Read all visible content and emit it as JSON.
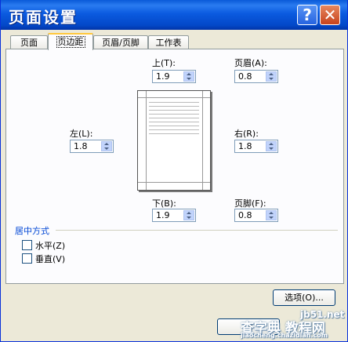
{
  "window": {
    "title": "页面设置"
  },
  "titlebar": {
    "help_glyph": "?",
    "close_glyph": "✕"
  },
  "tabs": [
    "页面",
    "页边距",
    "页眉/页脚",
    "工作表"
  ],
  "margins": {
    "top": {
      "label": "上(T):",
      "value": "1.9"
    },
    "header": {
      "label": "页眉(A):",
      "value": "0.8"
    },
    "left": {
      "label": "左(L):",
      "value": "1.8"
    },
    "right": {
      "label": "右(R):",
      "value": "1.8"
    },
    "bottom": {
      "label": "下(B):",
      "value": "1.9"
    },
    "footer": {
      "label": "页脚(F):",
      "value": "0.8"
    }
  },
  "center": {
    "group_label": "居中方式",
    "horizontal": {
      "label": "水平(Z)",
      "checked": false
    },
    "vertical": {
      "label": "垂直(V)",
      "checked": false
    }
  },
  "buttons": {
    "options": "选项(O)...",
    "ok": "确"
  },
  "watermark": {
    "line1": "jb51.net",
    "line2": "查字典 教程网",
    "line3": "jiaocheng.chazidian.com"
  }
}
